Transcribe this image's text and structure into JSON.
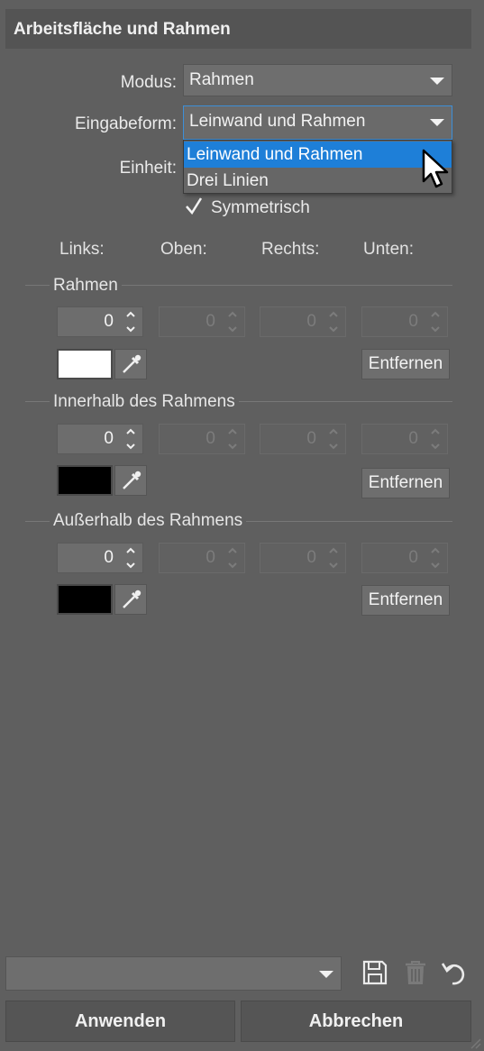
{
  "panel": {
    "title": "Arbeitsfläche und Rahmen"
  },
  "form": {
    "modus_label": "Modus:",
    "modus_value": "Rahmen",
    "eingabeform_label": "Eingabeform:",
    "eingabeform_value": "Leinwand und Rahmen",
    "einheit_label": "Einheit:",
    "dropdown_options": [
      "Leinwand und Rahmen",
      "Drei Linien"
    ],
    "symmetrisch_label": "Symmetrisch",
    "symmetrisch_checked": true
  },
  "columns": [
    "Links:",
    "Oben:",
    "Rechts:",
    "Unten:"
  ],
  "sections": [
    {
      "title": "Rahmen",
      "values": [
        "0",
        "0",
        "0",
        "0"
      ],
      "color": "#ffffff",
      "remove_label": "Entfernen"
    },
    {
      "title": "Innerhalb des Rahmens",
      "values": [
        "0",
        "0",
        "0",
        "0"
      ],
      "color": "#000000",
      "remove_label": "Entfernen"
    },
    {
      "title": "Außerhalb des Rahmens",
      "values": [
        "0",
        "0",
        "0",
        "0"
      ],
      "color": "#000000",
      "remove_label": "Entfernen"
    }
  ],
  "footer": {
    "preset_value": "",
    "save_icon": "save-icon",
    "trash_icon": "trash-icon",
    "reset_icon": "undo-icon",
    "apply_label": "Anwenden",
    "cancel_label": "Abbrechen"
  },
  "colors": {
    "accent": "#1e7fd8",
    "background": "#5f5f5f"
  }
}
